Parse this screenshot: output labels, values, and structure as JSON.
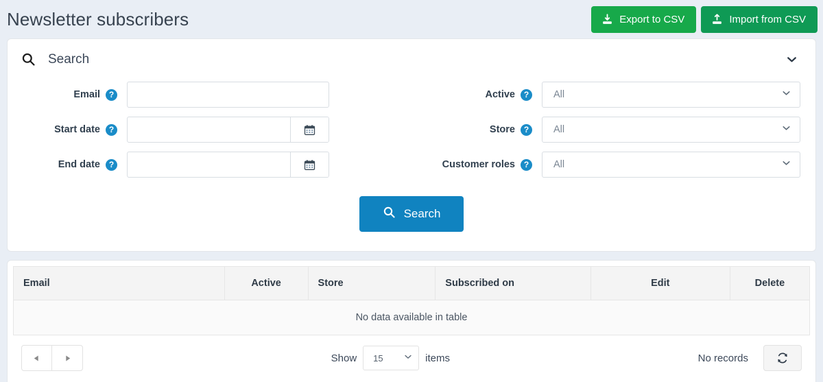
{
  "header": {
    "title": "Newsletter subscribers",
    "export_label": "Export to CSV",
    "import_label": "Import from CSV"
  },
  "search_panel": {
    "title": "Search",
    "left_fields": [
      {
        "label": "Email",
        "value": "",
        "type": "text"
      },
      {
        "label": "Start date",
        "value": "",
        "type": "date"
      },
      {
        "label": "End date",
        "value": "",
        "type": "date"
      }
    ],
    "right_fields": [
      {
        "label": "Active",
        "value": "All",
        "type": "select"
      },
      {
        "label": "Store",
        "value": "All",
        "type": "select"
      },
      {
        "label": "Customer roles",
        "value": "All",
        "type": "select"
      }
    ],
    "search_button": "Search"
  },
  "table": {
    "columns": [
      "Email",
      "Active",
      "Store",
      "Subscribed on",
      "Edit",
      "Delete"
    ],
    "rows": [],
    "empty_message": "No data available in table"
  },
  "footer": {
    "show_label": "Show",
    "items_label": "items",
    "page_size": "15",
    "records_label": "No records"
  },
  "colors": {
    "page_bg": "#e9eef5",
    "export_green": "#17a94a",
    "import_green": "#0f9a55",
    "search_blue": "#1083c0",
    "help_blue": "#1a8cc8"
  }
}
